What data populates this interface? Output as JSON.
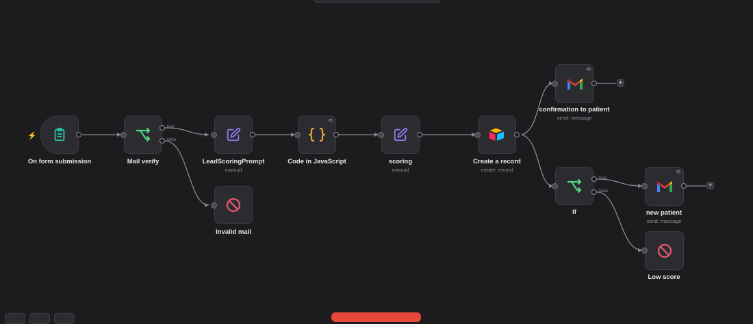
{
  "colors": {
    "background": "#1c1b1e",
    "node_fill": "#2c2b2f",
    "trigger_accent": "#ff6d5a",
    "form_icon": "#2bbfa0",
    "branch_icon": "#4fd67e",
    "edit_icon": "#8b7cf0",
    "code_icon": "#f1a63a",
    "stop_icon": "#e45a6b"
  },
  "nodes": {
    "form": {
      "label": "On form submission",
      "icon": "clipboard-icon"
    },
    "mail_verify": {
      "label": "Mail verify",
      "icon": "branch-icon",
      "true_label": "true",
      "false_label": "false"
    },
    "lead_prompt": {
      "label": "LeadScoringPrompt",
      "subtitle": "manual",
      "icon": "edit-icon"
    },
    "code": {
      "label": "Code in JavaScript",
      "icon": "code-braces-icon"
    },
    "scoring": {
      "label": "scoring",
      "subtitle": "manual",
      "icon": "edit-icon"
    },
    "create_record": {
      "label": "Create a record",
      "subtitle": "create: record",
      "icon": "airtable-icon"
    },
    "confirmation": {
      "label": "confirmation to patient",
      "subtitle": "send: message",
      "icon": "gmail-icon"
    },
    "if": {
      "label": "If",
      "icon": "branch-icon",
      "true_label": "true",
      "false_label": "false"
    },
    "new_patient": {
      "label": "new patient",
      "subtitle": "send: message",
      "icon": "gmail-icon"
    },
    "invalid_mail": {
      "label": "Invalid mail",
      "icon": "stop-icon"
    },
    "low_score": {
      "label": "Low score",
      "icon": "stop-icon"
    }
  },
  "plus_label": "+",
  "sync_glyph": "⟲",
  "trigger_glyph": "⚡"
}
